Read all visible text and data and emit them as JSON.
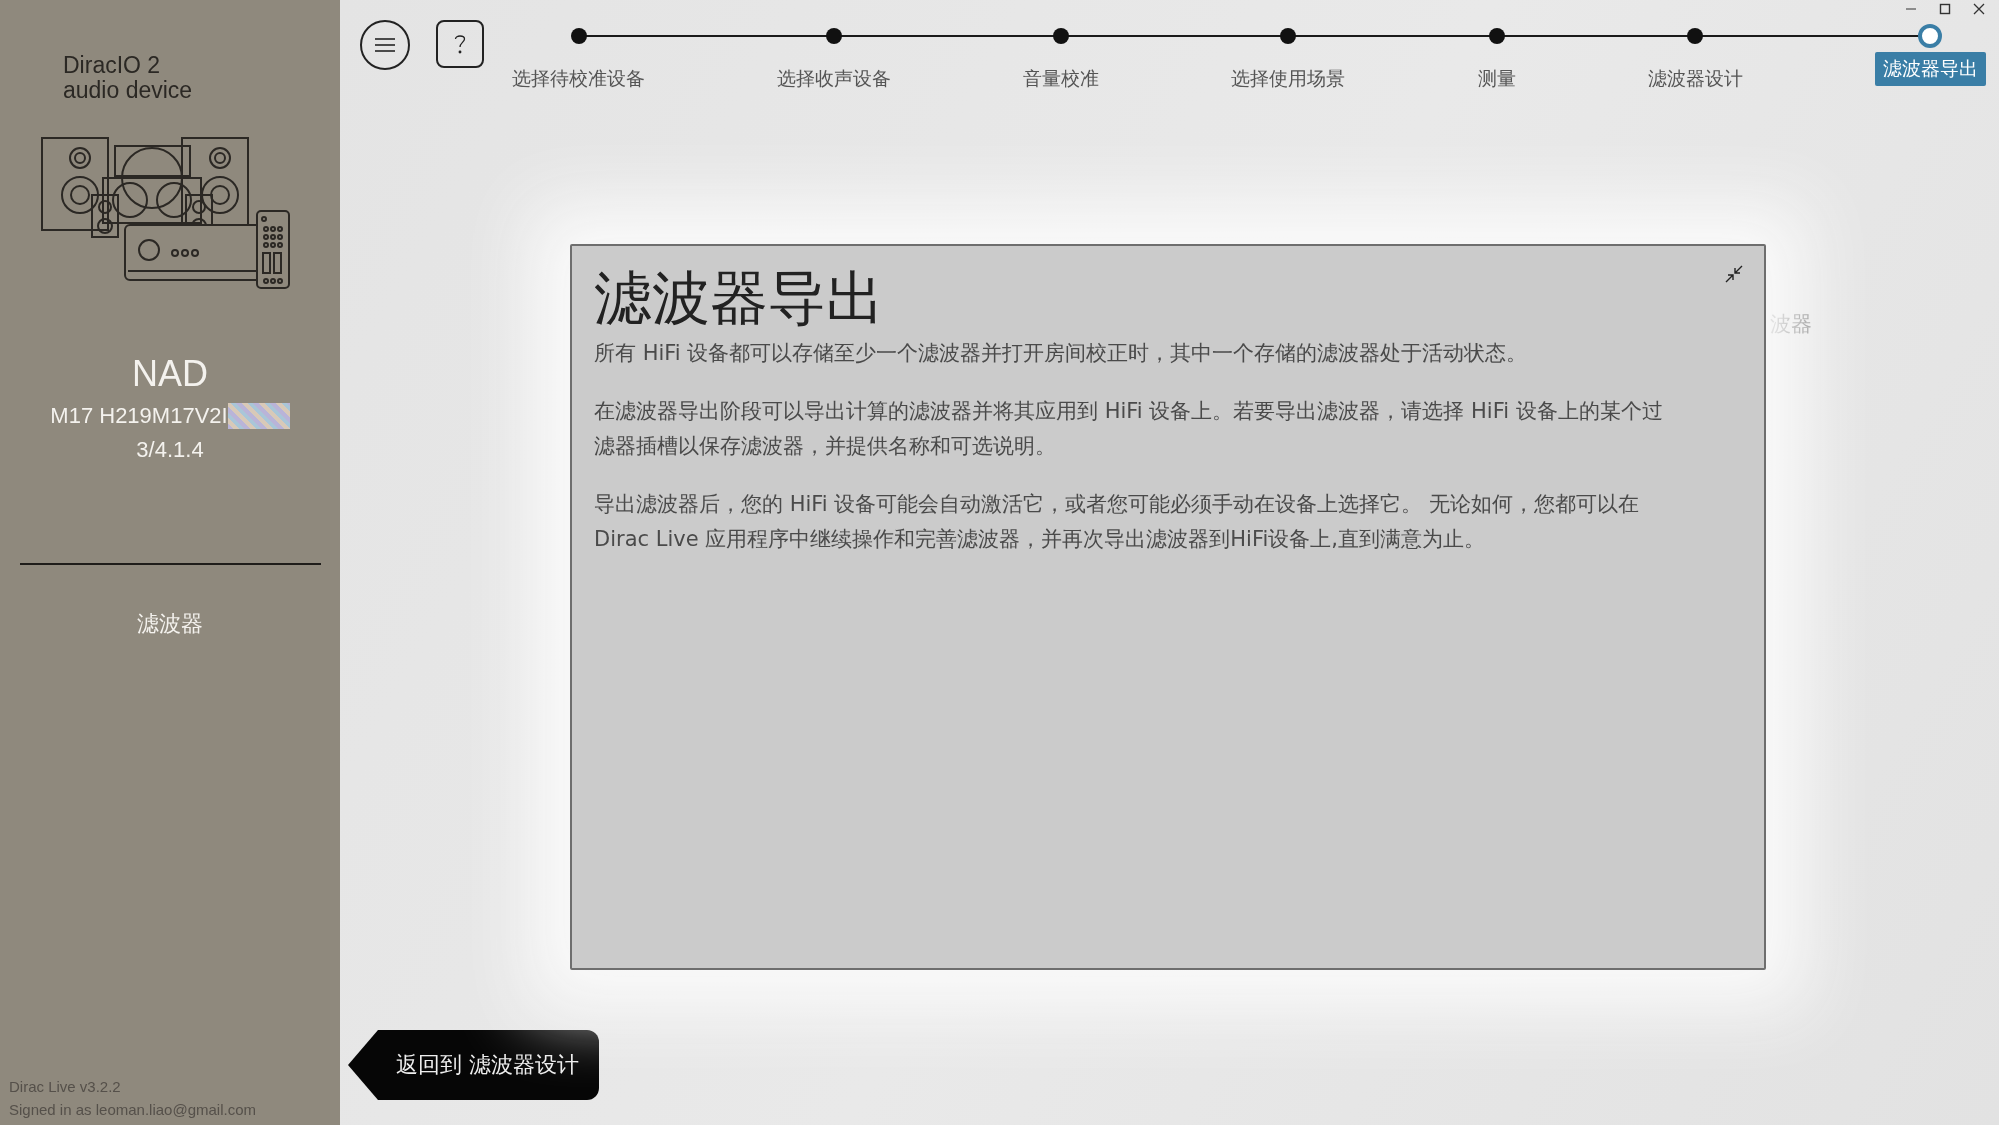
{
  "sidebar": {
    "product": "DiracIO 2",
    "product_sub": "audio device",
    "brand": "NAD",
    "model": "M17 H219M17V2I",
    "version": "3/4.1.4",
    "nav_items": [
      {
        "label": "滤波器",
        "selected": false
      }
    ],
    "app_version": "Dirac Live v3.2.2",
    "signed_in": "Signed in as leoman.liao@gmail.com"
  },
  "steps": [
    {
      "label": "选择待校准设备",
      "selected": false
    },
    {
      "label": "选择收声设备",
      "selected": false
    },
    {
      "label": "音量校准",
      "selected": false
    },
    {
      "label": "选择使用场景",
      "selected": false
    },
    {
      "label": "测量",
      "selected": false
    },
    {
      "label": "滤波器设计",
      "selected": false
    },
    {
      "label": "滤波器导出",
      "selected": true
    }
  ],
  "background_text": "波器",
  "dialog": {
    "title": "滤波器导出",
    "paragraphs": [
      "所有 HiFi 设备都可以存储至少一个滤波器并打开房间校正时，其中一个存储的滤波器处于活动状态。",
      "在滤波器导出阶段可以导出计算的滤波器并将其应用到 HiFi 设备上。若要导出滤波器，请选择 HiFi 设备上的某个过滤器插槽以保存滤波器，并提供名称和可选说明。",
      "导出滤波器后，您的 HiFi 设备可能会自动激活它，或者您可能必须手动在设备上选择它。 无论如何，您都可以在 Dirac Live 应用程序中继续操作和完善滤波器，并再次导出滤波器到HiFi设备上,直到满意为止。"
    ]
  },
  "back_button": "返回到 滤波器设计"
}
